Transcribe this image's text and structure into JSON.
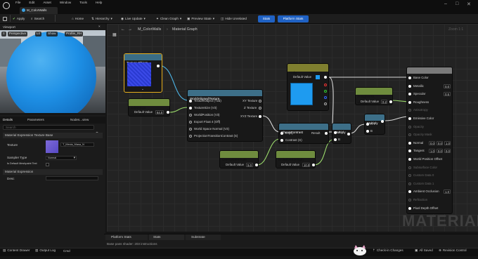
{
  "menu": [
    "File",
    "Edit",
    "Asset",
    "Window",
    "Tools",
    "Help"
  ],
  "document_tab": "M_ColorWalls",
  "toolbar": {
    "save": "",
    "apply": "Apply",
    "search": "Search",
    "home": "Home",
    "hierarchy": "Hierarchy",
    "live_update": "Live Update",
    "clean_graph": "Clean Graph",
    "preview_state": "Preview State",
    "hide_unrelated": "Hide Unrelated",
    "stats": "Stats",
    "platform_stats": "Platform Stats"
  },
  "viewport": {
    "tab": "Viewport",
    "buttons": [
      "Perspective",
      "Lit",
      "Show",
      "Profile_RH"
    ]
  },
  "details": {
    "tabs": [
      "Details",
      "Parameters",
      "Nodes...view"
    ],
    "search_placeholder": "Search",
    "section1": "Material Expression Texture Base",
    "texture_label": "Texture",
    "texture_value": "T_Mecia_Masa_N",
    "sampler_label": "Sampler Type",
    "sampler_value": "Normal",
    "world_tex_label": "Is Default Meshpaint Text",
    "section2": "Material Expression",
    "desc_label": "Desc"
  },
  "graph": {
    "breadcrumb_asset": "M_ColorWalls",
    "breadcrumb_page": "Material Graph",
    "zoom": "Zoom 1:1",
    "watermark": "MATERIAL",
    "nodes": {
      "texture_object": {
        "title": "Texture Object"
      },
      "tiling": {
        "title": "GrimeSize",
        "sub": "Param (0.5)",
        "default_label": "Default Value",
        "default_value": "64.0"
      },
      "world_aligned": {
        "title": "WorldAlignedTexture",
        "inputs": [
          "TextureObject (T2d)",
          "TextureSize (V3)",
          "WorldPosition (V3)",
          "Export Float 4 (Off)",
          "World Space Normal (V3)",
          "ProjectionTransitionContrast (S)"
        ],
        "outputs": [
          "XY Texture",
          "Z Texture",
          "XYZ Texture"
        ]
      },
      "color": {
        "title": "Color",
        "sub": "Param (0.1,0.6,1.0,1)",
        "default_label": "Default Value"
      },
      "cheap_contrast": {
        "title": "CheapContrast",
        "inputs": [
          "In (V)",
          "Contrast (S)"
        ],
        "output": "Result"
      },
      "contrast_strength": {
        "title": "ContrastStrength",
        "sub": "Param (5)",
        "default_label": "Default Value",
        "default_value": "5.0"
      },
      "emissive_strength": {
        "title": "EmissiveStrength",
        "sub": "Param (10)",
        "default_label": "Default Value",
        "default_value": "10.0"
      },
      "multiply1": {
        "title": "Multiply",
        "pins": [
          "A",
          "B"
        ]
      },
      "multiply2": {
        "title": "Multiply",
        "pins": [
          "A",
          "B"
        ]
      },
      "roughness": {
        "title": "Roughness",
        "sub": "Param (0.2)",
        "default_label": "Default Value",
        "default_value": "0.2"
      },
      "result": {
        "title": "M_ColorWalls",
        "pins": [
          "Base Color",
          "Metallic",
          "Specular",
          "Roughness",
          "Anisotropy",
          "Emissive Color",
          "Opacity",
          "Opacity Mask",
          "Normal",
          "Tangent",
          "World Position Offset",
          "Subsurface Color",
          "Custom Data 0",
          "Custom Data 1",
          "Ambient Occlusion",
          "Refraction",
          "Pixel Depth Offset"
        ],
        "metallic_value": "0.0",
        "specular_value": "0.5",
        "normal_values": [
          "0.0",
          "0.0",
          "1.0"
        ],
        "tangent_values": [
          "1.0",
          "0.0",
          "0.0"
        ],
        "ao_value": "1.0"
      }
    }
  },
  "bottom_tabs": [
    "Platform Stats",
    "Stats",
    "Substrate"
  ],
  "bottom_text": "Base pass shader: 203 instructions",
  "status": {
    "content_drawer": "Content Drawer",
    "output_log": "Output Log",
    "cmd": "Cmd",
    "console_placeholder": "Enter Console Command",
    "check_in": "Check-in Changes",
    "unsaved": "All Saved",
    "revision": "Revision Control"
  },
  "colors": {
    "accent": "#2062c4",
    "texture_node": "#d9a521",
    "param_node": "#6f8c3e",
    "func_node": "#3d6f88",
    "result_node": "#7a7a7a",
    "color_swatch": "#1e9bf0"
  }
}
